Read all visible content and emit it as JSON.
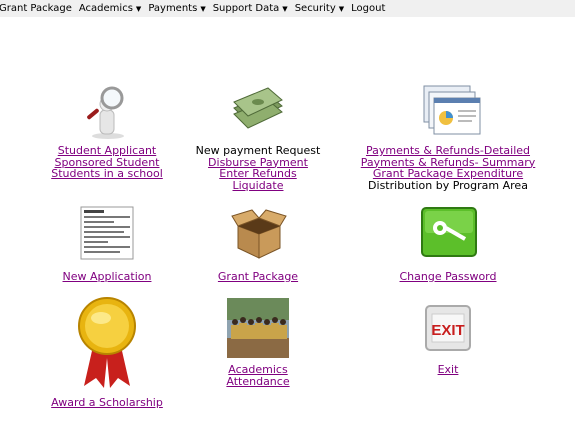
{
  "menu": {
    "items": [
      {
        "label": "Grant Package",
        "has_dropdown": false
      },
      {
        "label": "Academics",
        "has_dropdown": true
      },
      {
        "label": "Payments",
        "has_dropdown": true
      },
      {
        "label": "Support Data",
        "has_dropdown": true
      },
      {
        "label": "Security",
        "has_dropdown": true
      },
      {
        "label": "Logout",
        "has_dropdown": false
      }
    ],
    "dropdown_glyph": "▼"
  },
  "colors": {
    "link": "#800080",
    "menubar": "#f0f0f0"
  },
  "tiles": {
    "student": {
      "icon": "magnifier-man-icon",
      "links": [
        "Student Applicant",
        "Sponsored Student",
        "Students in a school"
      ]
    },
    "payment": {
      "icon": "money-stack-icon",
      "text": "New payment Request",
      "links": [
        "Disburse Payment",
        "Enter Refunds",
        "Liquidate"
      ]
    },
    "reports": {
      "icon": "report-screens-icon",
      "links": [
        "Payments & Refunds-Detailed",
        "Payments & Refunds- Summary",
        "Grant Package Expenditure"
      ],
      "text": "Distribution by Program Area"
    },
    "application": {
      "icon": "form-document-icon",
      "link": "New Application"
    },
    "grant": {
      "icon": "open-box-icon",
      "link": "Grant Package"
    },
    "password": {
      "icon": "key-icon",
      "link": "Change Password"
    },
    "award": {
      "icon": "award-ribbon-icon",
      "link": "Award a Scholarship"
    },
    "academics": {
      "icon": "students-photo-icon",
      "links": [
        "Academics",
        "Attendance"
      ]
    },
    "exit": {
      "icon": "exit-sign-icon",
      "link": "Exit"
    }
  }
}
